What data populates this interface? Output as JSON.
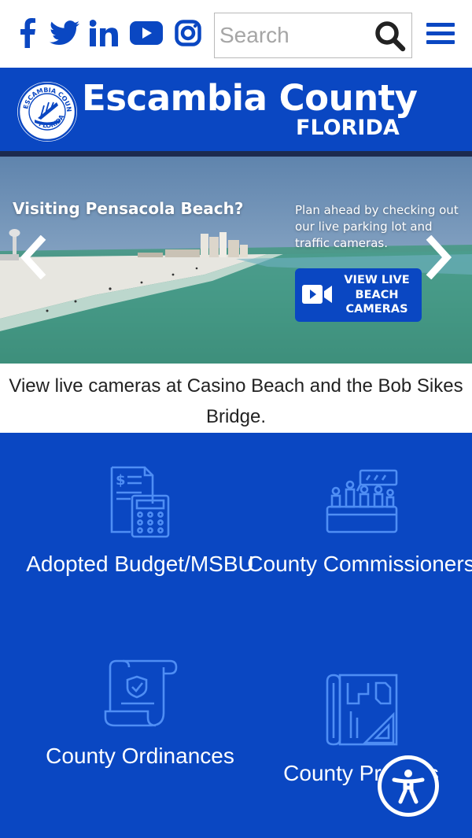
{
  "social": {
    "facebook": "facebook-icon",
    "twitter": "twitter-icon",
    "linkedin": "linkedin-icon",
    "youtube": "youtube-icon",
    "instagram": "instagram-icon"
  },
  "search": {
    "placeholder": "Search",
    "value": ""
  },
  "brand": {
    "name": "Escambia County",
    "subtitle": "FLORIDA"
  },
  "hero": {
    "headline": "Visiting Pensacola Beach?",
    "note": "Plan ahead by checking out our live parking lot and traffic cameras.",
    "button_label": "VIEW LIVE BEACH CAMERAS",
    "caption": "View live cameras at Casino Beach and the Bob Sikes Bridge."
  },
  "tiles": [
    {
      "label": "Adopted Budget/MSBU",
      "icon": "budget-calculator-icon"
    },
    {
      "label": "County Commissioners",
      "icon": "commission-dais-icon"
    },
    {
      "label": "County Ordinances",
      "icon": "ordinance-scroll-icon"
    },
    {
      "label": "County Projects",
      "icon": "blueprint-icon"
    }
  ],
  "colors": {
    "brand_blue": "#0a47c2",
    "strip_navy": "#1c2a4e",
    "white": "#ffffff"
  }
}
